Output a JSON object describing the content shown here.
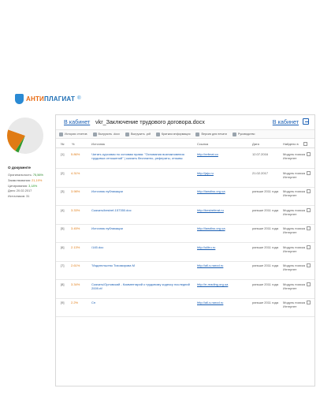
{
  "brand": {
    "name_part1": "АНТИ",
    "name_part2": "ПЛАГИАТ",
    "reg": "®"
  },
  "colors": {
    "original": "#2b8a2b",
    "borrowing": "#e07b14",
    "citation": "#2e9a2e",
    "link": "#1a5fb4"
  },
  "sidebar": {
    "title": "О документе",
    "stats": [
      {
        "label": "Оригинальность:",
        "value": "75,56%"
      },
      {
        "label": "Заимствования:",
        "value": "21,19%"
      },
      {
        "label": "Цитирования:",
        "value": "3,18%"
      },
      {
        "label": "Дата:",
        "value": "20.02.2017"
      },
      {
        "label": "Источников:",
        "value": "31"
      }
    ],
    "pie": {
      "original": 75.56,
      "borrowing": 21.19,
      "citation": 3.18
    }
  },
  "header": {
    "back_left": "В кабинет",
    "doc_name": "vkr_Заключение трудового договора.docx",
    "back_right": "В кабинет"
  },
  "toolbar": [
    {
      "icon": "history-icon",
      "label": "История отчетов"
    },
    {
      "icon": "download-icon",
      "label": "Выгрузить .docx"
    },
    {
      "icon": "pdf-icon",
      "label": "Выгрузить .pdf"
    },
    {
      "icon": "info-icon",
      "label": "Краткая информация"
    },
    {
      "icon": "print-icon",
      "label": "Версия для печати"
    },
    {
      "icon": "manual-icon",
      "label": "Руководство"
    }
  ],
  "columns": {
    "num": "№",
    "pct": "%",
    "source": "Источник",
    "link": "Ссылка",
    "date": "Дата",
    "found": "Найдено в"
  },
  "rows": [
    {
      "num": "[1]",
      "pct": "5.86%",
      "source": "Читать курсовая по основам права: \"Основания возникновения трудовых отношений\" | скачать бесплатно, рефераты, отзывы",
      "link": "http://referat.co",
      "date": "12.07.2016",
      "found": "Модуль поиска Интернет"
    },
    {
      "num": "[2]",
      "pct": "4.31%",
      "source": "",
      "link": "http://jajo.ru",
      "date": "21.02.2017",
      "found": "Модуль поиска Интернет"
    },
    {
      "num": "[3]",
      "pct": "3.98%",
      "source": "Источник публикации",
      "link": "http://lawdiss.org.ua",
      "date": "раньше 2011 года",
      "found": "Модуль поиска Интернет"
    },
    {
      "num": "[4]",
      "pct": "3.33%",
      "source": "Скачать/bestref-157350.doc",
      "link": "http://bestreferat.ru",
      "date": "раньше 2011 года",
      "found": "Модуль поиска Интернет"
    },
    {
      "num": "[5]",
      "pct": "3.45%",
      "source": "Источник публикации",
      "link": "http://lawdiss.org.ua",
      "date": "раньше 2011 года",
      "found": "Модуль поиска Интернет"
    },
    {
      "num": "[6]",
      "pct": "2.13%",
      "source": "/145.doc",
      "link": "http://ulitru.ru",
      "date": "раньше 2011 года",
      "found": "Модуль поиска Интернет"
    },
    {
      "num": "[7]",
      "pct": "2.61%",
      "source": "\"Издательство Тихомирова М",
      "link": "http://all-s.narod.ru",
      "date": "раньше 2011 года",
      "found": "Модуль поиска Интернет"
    },
    {
      "num": "[8]",
      "pct": "3.34%",
      "source": "Скачать/Орловский - Комментарий к трудовому кодексу последний 2009.rtf",
      "link": "http://e-reading.org.ua",
      "date": "раньше 2011 года",
      "found": "Модуль поиска Интернет"
    },
    {
      "num": "[9]",
      "pct": "2.2%",
      "source": "Сн",
      "link": "http://all-s.narod.ru",
      "date": "раньше 2011 года",
      "found": "Модуль поиска Интернет"
    }
  ]
}
